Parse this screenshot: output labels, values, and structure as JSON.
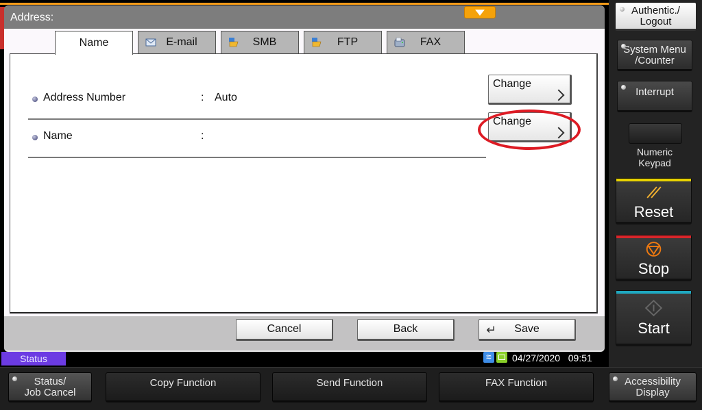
{
  "panel": {
    "title": "Address:",
    "tabs": [
      {
        "label": "Name",
        "icon": "none",
        "active": true
      },
      {
        "label": "E-mail",
        "icon": "envelope-icon",
        "active": false
      },
      {
        "label": "SMB",
        "icon": "folder-network-icon",
        "active": false
      },
      {
        "label": "FTP",
        "icon": "folder-network-icon",
        "active": false
      },
      {
        "label": "FAX",
        "icon": "fax-machine-icon",
        "active": false
      }
    ],
    "rows": [
      {
        "label": "Address Number",
        "separator": ":",
        "value": "Auto",
        "button": "Change"
      },
      {
        "label": "Name",
        "separator": ":",
        "value": "",
        "button": "Change",
        "highlighted": true
      }
    ],
    "footer": {
      "cancel": "Cancel",
      "back": "Back",
      "save": "Save",
      "save_icon": "↵"
    }
  },
  "statusbar": {
    "status_label": "Status",
    "date": "04/27/2020",
    "time": "09:51",
    "icons": [
      "wifi-icon",
      "network-icon"
    ]
  },
  "sidebar": {
    "auth": "Authentic./\nLogout",
    "auth_line1": "Authentic./",
    "auth_line2": "Logout",
    "system_menu_line1": "System Menu",
    "system_menu_line2": "/Counter",
    "interrupt": "Interrupt",
    "numeric_keypad_line1": "Numeric",
    "numeric_keypad_line2": "Keypad",
    "reset": "Reset",
    "stop": "Stop",
    "start": "Start"
  },
  "bottom": {
    "status_job_line1": "Status/",
    "status_job_line2": "Job Cancel",
    "copy": "Copy Function",
    "send": "Send Function",
    "fax": "FAX Function",
    "accessibility_line1": "Accessibility",
    "accessibility_line2": "Display"
  },
  "colors": {
    "accent_orange": "#f59c1a",
    "highlight_red": "#dd1b24",
    "status_purple": "#6c3be3",
    "reset_bar": "#e8d200",
    "stop_bar": "#d8262b",
    "start_bar": "#1fa8c0"
  }
}
